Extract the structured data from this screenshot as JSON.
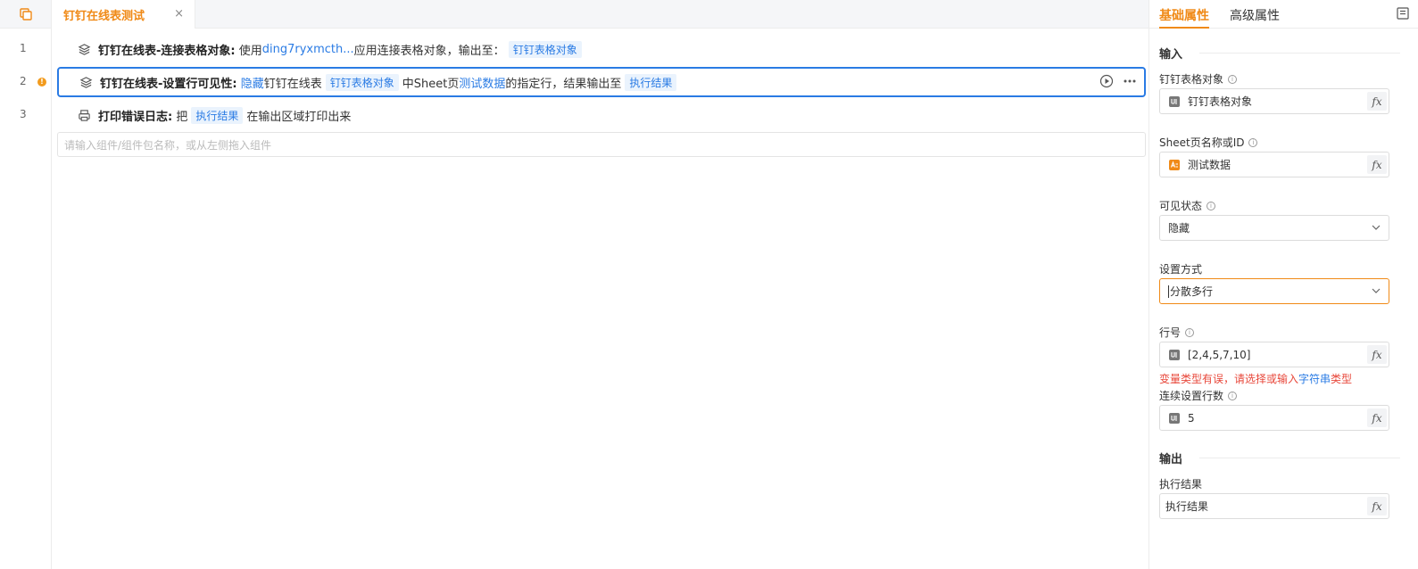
{
  "tab": {
    "title": "钉钉在线表测试",
    "close": "×"
  },
  "rows": [
    {
      "line": "1",
      "title": "钉钉在线表-连接表格对象:",
      "t1": "使用",
      "link1": "ding7ryxmcth...",
      "t2": "应用连接表格对象，输出至：",
      "tag1": "钉钉表格对象"
    },
    {
      "line": "2",
      "warn": "!",
      "title": "钉钉在线表-设置行可见性:",
      "link1": "隐藏",
      "t1": "钉钉在线表",
      "tag1": "钉钉表格对象",
      "t2": "中Sheet页",
      "link2": "测试数据",
      "t3": "的指定行，结果输出至",
      "tag2": "执行结果"
    },
    {
      "line": "3",
      "title": "打印错误日志:",
      "t1": "把",
      "tag1": "执行结果",
      "t2": "在输出区域打印出来"
    }
  ],
  "add_placeholder": "请输入组件/组件包名称，或从左侧拖入组件",
  "panel": {
    "tab_basic": "基础属性",
    "tab_advanced": "高级属性",
    "input_section": "输入",
    "output_section": "输出",
    "fields": {
      "table_obj": {
        "label": "钉钉表格对象",
        "value": "钉钉表格对象"
      },
      "sheet": {
        "label": "Sheet页名称或ID",
        "value": "测试数据"
      },
      "visible": {
        "label": "可见状态",
        "value": "隐藏"
      },
      "mode": {
        "label": "设置方式",
        "value": "分散多行"
      },
      "rows": {
        "label": "行号",
        "value": "[2,4,5,7,10]"
      },
      "count": {
        "label": "连续设置行数",
        "value": "5"
      },
      "result": {
        "label": "执行结果",
        "value": "执行结果"
      }
    },
    "error": {
      "part1": "变量类型有误，请选择或输入",
      "link": "字符串",
      "part2": "类型"
    },
    "fx": "fx",
    "info": "i"
  },
  "colors": {
    "accent": "#f08a17",
    "link": "#2a7be4",
    "error": "#e8483b",
    "selected_border": "#2a7be4"
  },
  "icons": [
    "layers-icon",
    "printer-icon",
    "play-icon",
    "more-icon",
    "variable-icon",
    "text-var-icon",
    "chevron-down-icon",
    "panel-toggle-icon",
    "workspace-icon"
  ]
}
